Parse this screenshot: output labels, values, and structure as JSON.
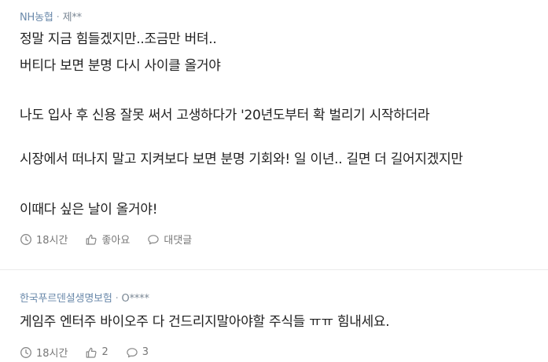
{
  "comments": [
    {
      "company": "NH농협",
      "separator": "·",
      "author": "제**",
      "lines": [
        "정말 지금 힘들겠지만..조금만 버텨..",
        "버티다 보면 분명 다시 사이클 올거야",
        "나도 입사 후 신용 잘못 써서 고생하다가 '20년도부터 확 벌리기 시작하더라",
        "시장에서 떠나지 말고 지켜보다 보면 분명 기회와! 일 이년.. 길면 더 길어지겠지만",
        "이때다 싶은 날이 올거야!"
      ],
      "time": "18시간",
      "like_label": "좋아요",
      "reply_label": "대댓글"
    },
    {
      "company": "한국푸르덴셜생명보험",
      "separator": "·",
      "author": "O****",
      "lines": [
        "게임주 엔터주 바이오주 다 건드리지말아야할 주식들 ㅠㅠ 힘내세요."
      ],
      "time": "18시간",
      "like_label": "2",
      "reply_label": "3"
    }
  ],
  "icons": {
    "clock": "clock-icon",
    "like": "thumbs-up-icon",
    "reply": "speech-bubble-icon"
  },
  "colors": {
    "meta": "#6b8aab",
    "text": "#1f1f1f",
    "action": "#777777",
    "divider": "#ebebeb"
  }
}
